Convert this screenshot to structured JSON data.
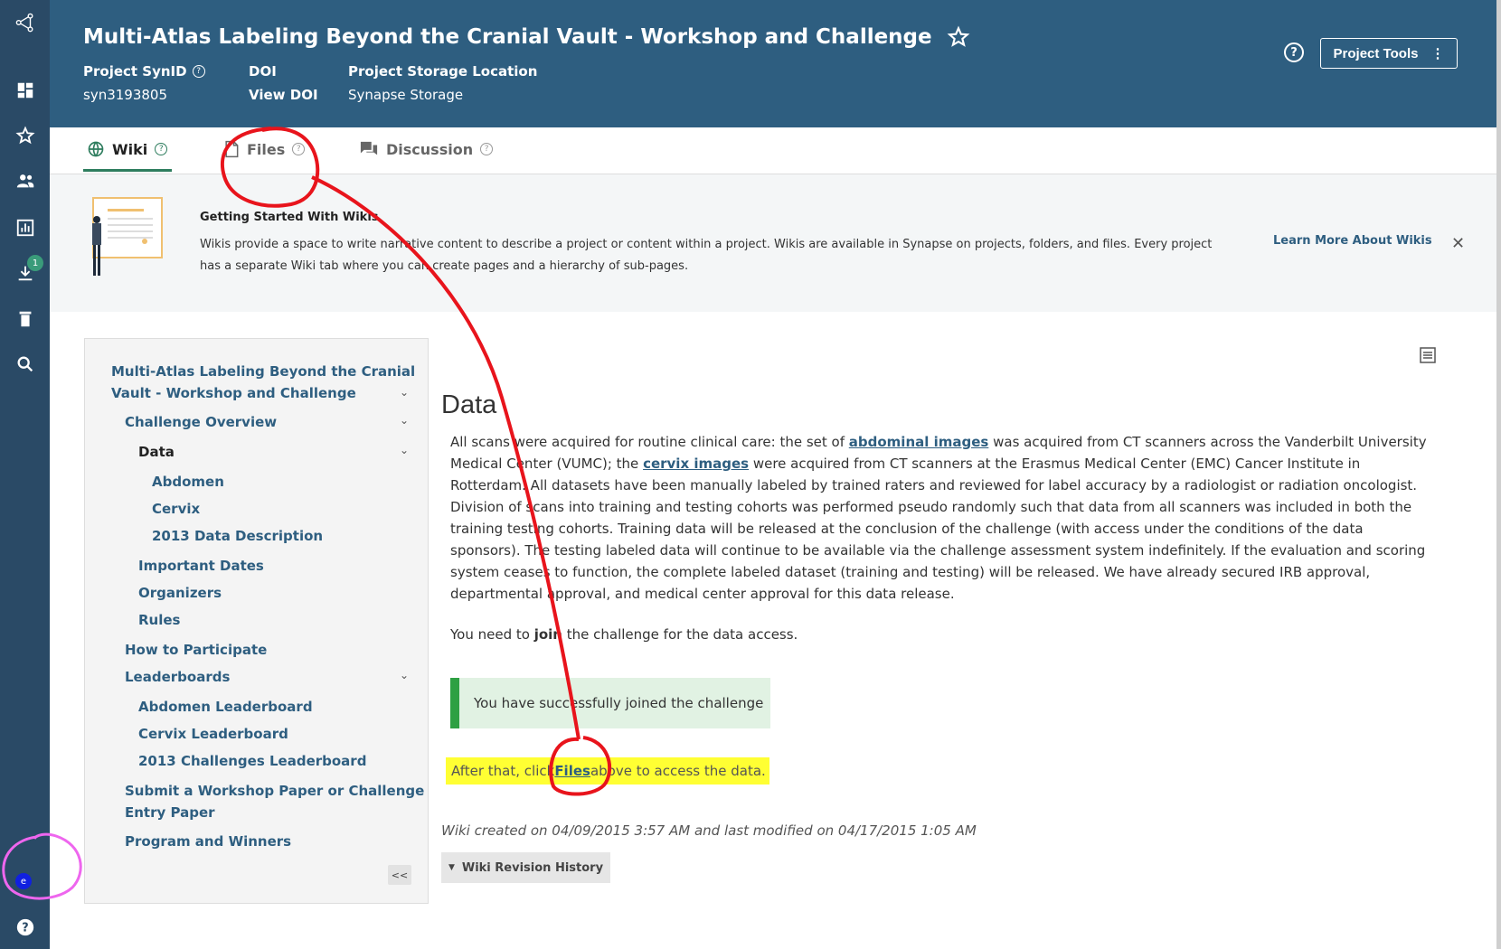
{
  "header": {
    "title": "Multi-Atlas Labeling Beyond the Cranial Vault - Workshop and Challenge",
    "synid_label": "Project SynID",
    "synid": "syn3193805",
    "doi_label": "DOI",
    "doi_link": "View DOI",
    "storage_label": "Project Storage Location",
    "storage": "Synapse Storage",
    "tools_label": "Project Tools"
  },
  "sidenav": {
    "download_badge": "1",
    "avatar_letter": "e"
  },
  "tabs": [
    {
      "label": "Wiki"
    },
    {
      "label": "Files"
    },
    {
      "label": "Discussion"
    }
  ],
  "banner": {
    "title": "Getting Started With Wikis",
    "text": "Wikis provide a space to write narrative content to describe a project or content within a project. Wikis are available in Synapse on projects, folders, and files. Every project has a separate Wiki tab where you can create pages and a hierarchy of sub-pages.",
    "link": "Learn More About Wikis"
  },
  "wikinav": {
    "root_line1": "Multi-Atlas Labeling Beyond the Cranial",
    "root_line2": "Vault - Workshop and Challenge",
    "challenge_overview": "Challenge Overview",
    "data": "Data",
    "abdomen": "Abdomen",
    "cervix": "Cervix",
    "data_desc": "2013 Data Description",
    "important_dates": "Important Dates",
    "organizers": "Organizers",
    "rules": "Rules",
    "how_to": "How to Participate",
    "leaderboards": "Leaderboards",
    "abdomen_lb": "Abdomen Leaderboard",
    "cervix_lb": "Cervix Leaderboard",
    "challenges_lb": "2013 Challenges Leaderboard",
    "submit_line1": "Submit a Workshop Paper or Challenge",
    "submit_line2": "Entry Paper",
    "program": "Program and Winners",
    "collapse": "<<"
  },
  "content": {
    "heading": "Data",
    "p_part1": "All scans were acquired for routine clinical care: the set of ",
    "link_abdominal": "abdominal images",
    "p_part2": " was acquired from CT scanners across the Vanderbilt University Medical Center (VUMC); the ",
    "link_cervix": "cervix images",
    "p_part3": " were acquired from CT scanners at the Erasmus Medical Center (EMC) Cancer Institute in Rotterdam. All datasets have been manually labeled by trained raters and reviewed for label accuracy by a radiologist or radiation oncologist. Division of scans into training and testing cohorts was performed pseudo randomly such that data from all scanners was included in both the training testing cohorts. Training data will be released at the conclusion of the challenge (with access under the conditions of the data sponsors). The testing labeled data will continue to be available via the challenge assessment system indefinitely. If the evaluation and scoring system ceases to function, the complete labeled dataset (training and testing) will be released. We have already secured IRB approval, departmental approval, and medical center approval for this data release.",
    "join_pre": "You need to ",
    "join_word": "join",
    "join_post": " the challenge for the data access.",
    "success": "You have successfully joined the challenge",
    "after_pre": "After that, click ",
    "after_files": "Files",
    "after_post": " above to access the data.",
    "created": "Wiki created on 04/09/2015 3:57 AM and last modified on 04/17/2015 1:05 AM",
    "revision": "Wiki Revision History"
  },
  "colors": {
    "header_bg": "#2e5e80",
    "sidenav_bg": "#2a4a66",
    "accent_green": "#2e7d5e",
    "highlight": "#ffff33",
    "annotation_red": "#e8141c",
    "annotation_pink": "#ee66ee"
  }
}
